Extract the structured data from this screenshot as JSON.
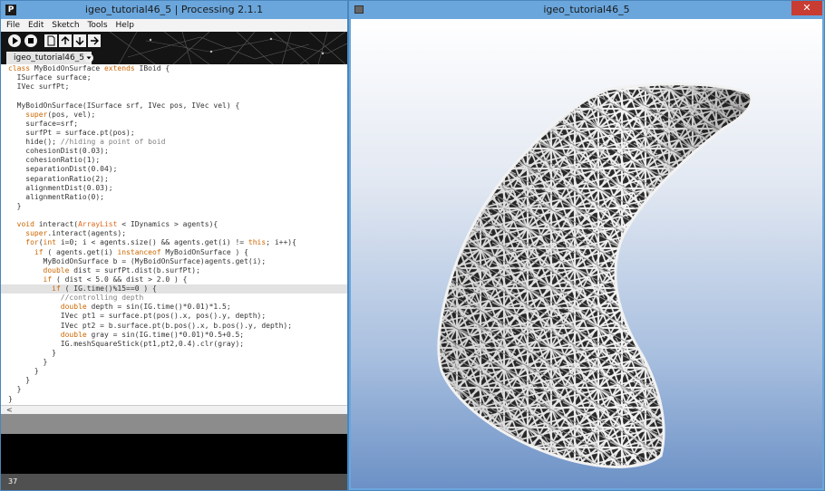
{
  "editor_window": {
    "title": "igeo_tutorial46_5 | Processing 2.1.1",
    "app_icon": "P",
    "menu": [
      "File",
      "Edit",
      "Sketch",
      "Tools",
      "Help"
    ],
    "toolbar": {
      "run_icon": "play-icon",
      "stop_icon": "stop-icon",
      "new_icon": "new-file-icon",
      "open_icon": "open-icon",
      "save_icon": "save-icon",
      "export_icon": "export-icon"
    },
    "tab_label": "igeo_tutorial46_5",
    "tab_menu_icon": "chevron-down-icon",
    "scroll_left_glyph": "<",
    "line_number": "37",
    "code_lines": [
      "class MyBoidOnSurface extends IBoid {",
      "  ISurface surface;",
      "  IVec surfPt;",
      "",
      "  MyBoidOnSurface(ISurface srf, IVec pos, IVec vel) {",
      "    super(pos, vel);",
      "    surface=srf;",
      "    surfPt = surface.pt(pos);",
      "    hide(); //hiding a point of boid",
      "    cohesionDist(0.03);",
      "    cohesionRatio(1);",
      "    separationDist(0.04);",
      "    separationRatio(2);",
      "    alignmentDist(0.03);",
      "    alignmentRatio(0);",
      "  }",
      "",
      "  void interact(ArrayList < IDynamics > agents){",
      "    super.interact(agents);",
      "    for(int i=0; i < agents.size() && agents.get(i) != this; i++){",
      "      if ( agents.get(i) instanceof MyBoidOnSurface ) {",
      "        MyBoidOnSurface b = (MyBoidOnSurface)agents.get(i);",
      "        double dist = surfPt.dist(b.surfPt);",
      "        if ( dist < 5.0 && dist > 2.0 ) {",
      "          if ( IG.time()%15==0 ) {",
      "            //controlling depth",
      "            double depth = sin(IG.time()*0.01)*1.5;",
      "            IVec pt1 = surface.pt(pos().x, pos().y, depth);",
      "            IVec pt2 = b.surface.pt(b.pos().x, b.pos().y, depth);",
      "            double gray = sin(IG.time()*0.01)*0.5+0.5;",
      "            IG.meshSquareStick(pt1,pt2,0.4).clr(gray);",
      "          }",
      "        }",
      "      }",
      "    }",
      "  }",
      "}"
    ]
  },
  "sketch_window": {
    "title": "igeo_tutorial46_5",
    "window_icon": "window-icon",
    "close_glyph": "✕",
    "minimize_glyph": "—",
    "maximize_glyph": "□"
  },
  "colors": {
    "titlebar": "#6aa6dc",
    "close": "#c83c32",
    "keyword": "#cc6600",
    "type": "#e2661a",
    "comment": "#7e7e7e"
  }
}
